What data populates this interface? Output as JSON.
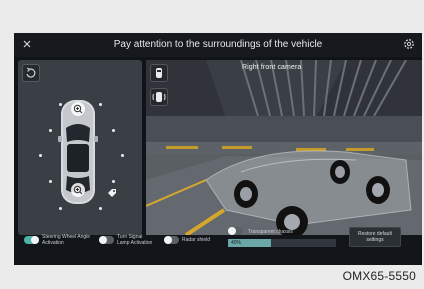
{
  "header": {
    "title": "Pay attention to the surroundings of the vehicle",
    "close_icon": "close-icon",
    "settings_icon": "gear-icon"
  },
  "left_panel": {
    "view_toggle_icon": "rotate-view-icon",
    "zoom_icon": "zoom-in-icon",
    "tag_icon": "tag-icon"
  },
  "camera": {
    "label": "Right front camera"
  },
  "controls": {
    "steering": {
      "label_line1": "Steering Wheel Angle",
      "label_line2": "Activation",
      "state": "on"
    },
    "turn_signal": {
      "label_line1": "Turn Signal",
      "label_line2": "Lamp Activation",
      "state": "off"
    },
    "radar_shield": {
      "label": "Radar shield",
      "state": "off"
    },
    "transparent_chassis": {
      "label": "Transparent chassis",
      "state": "off",
      "progress_text": "40%",
      "progress_value": 0.4
    },
    "restore": {
      "label_line1": "Restore default",
      "label_line2": "settings"
    }
  },
  "caption": "OMX65-5550",
  "colors": {
    "accent_toggle": "#4fb3a4",
    "progress": "#6aa7a6",
    "screen_bg": "#101419"
  }
}
